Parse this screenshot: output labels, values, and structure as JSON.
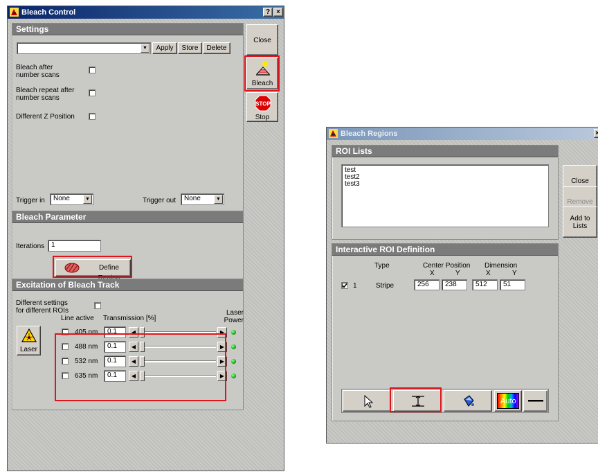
{
  "bleach_control": {
    "title": "Bleach Control",
    "title_buttons": {
      "help": "?",
      "close": "×"
    },
    "side_buttons": {
      "close": "Close",
      "bleach": "Bleach",
      "stop": "Stop",
      "stop_sign": "STOP"
    },
    "settings": {
      "header": "Settings",
      "combo_value": "",
      "apply": "Apply",
      "store": "Store",
      "delete": "Delete",
      "bleach_after": "Bleach after\nnumber scans",
      "bleach_repeat": "Bleach repeat after\nnumber scans",
      "diff_z": "Different Z Position",
      "trigger_in_label": "Trigger in",
      "trigger_in_value": "None",
      "trigger_out_label": "Trigger out",
      "trigger_out_value": "None"
    },
    "bleach_parameter": {
      "header": "Bleach Parameter",
      "iterations_label": "Iterations",
      "iterations_value": "1",
      "define_region": "Define Region"
    },
    "excitation": {
      "header": "Excitation of Bleach Track",
      "diff_settings": "Different settings\nfor different ROIs",
      "laser_button": "Laser",
      "line_active": "Line active",
      "transmission": "Transmission [%]",
      "laser_power": "Laser\nPower",
      "lines": [
        {
          "wavelength": "405 nm",
          "value": "0.1"
        },
        {
          "wavelength": "488 nm",
          "value": "0.1"
        },
        {
          "wavelength": "532 nm",
          "value": "0.1"
        },
        {
          "wavelength": "635 nm",
          "value": "0.1"
        }
      ]
    }
  },
  "bleach_regions": {
    "title": "Bleach Regions",
    "title_close": "×",
    "roi_lists": {
      "header": "ROI Lists",
      "items": [
        "test",
        "test2",
        "test3"
      ]
    },
    "side_buttons": {
      "close": "Close",
      "remove": "Remove",
      "add_to_lists": "Add to\nLists"
    },
    "interactive": {
      "header": "Interactive ROI Definition",
      "col_type": "Type",
      "col_center": "Center Position",
      "col_dimension": "Dimension",
      "x": "X",
      "y": "Y",
      "row": {
        "index": "1",
        "type": "Stripe",
        "cx": "256",
        "cy": "238",
        "dx": "512",
        "dy": "51"
      }
    },
    "toolbar": {
      "auto": "Auto"
    }
  },
  "colors": {
    "highlight": "#e0141a",
    "header": "#7b7b7b",
    "title_active": "#0a246a"
  }
}
